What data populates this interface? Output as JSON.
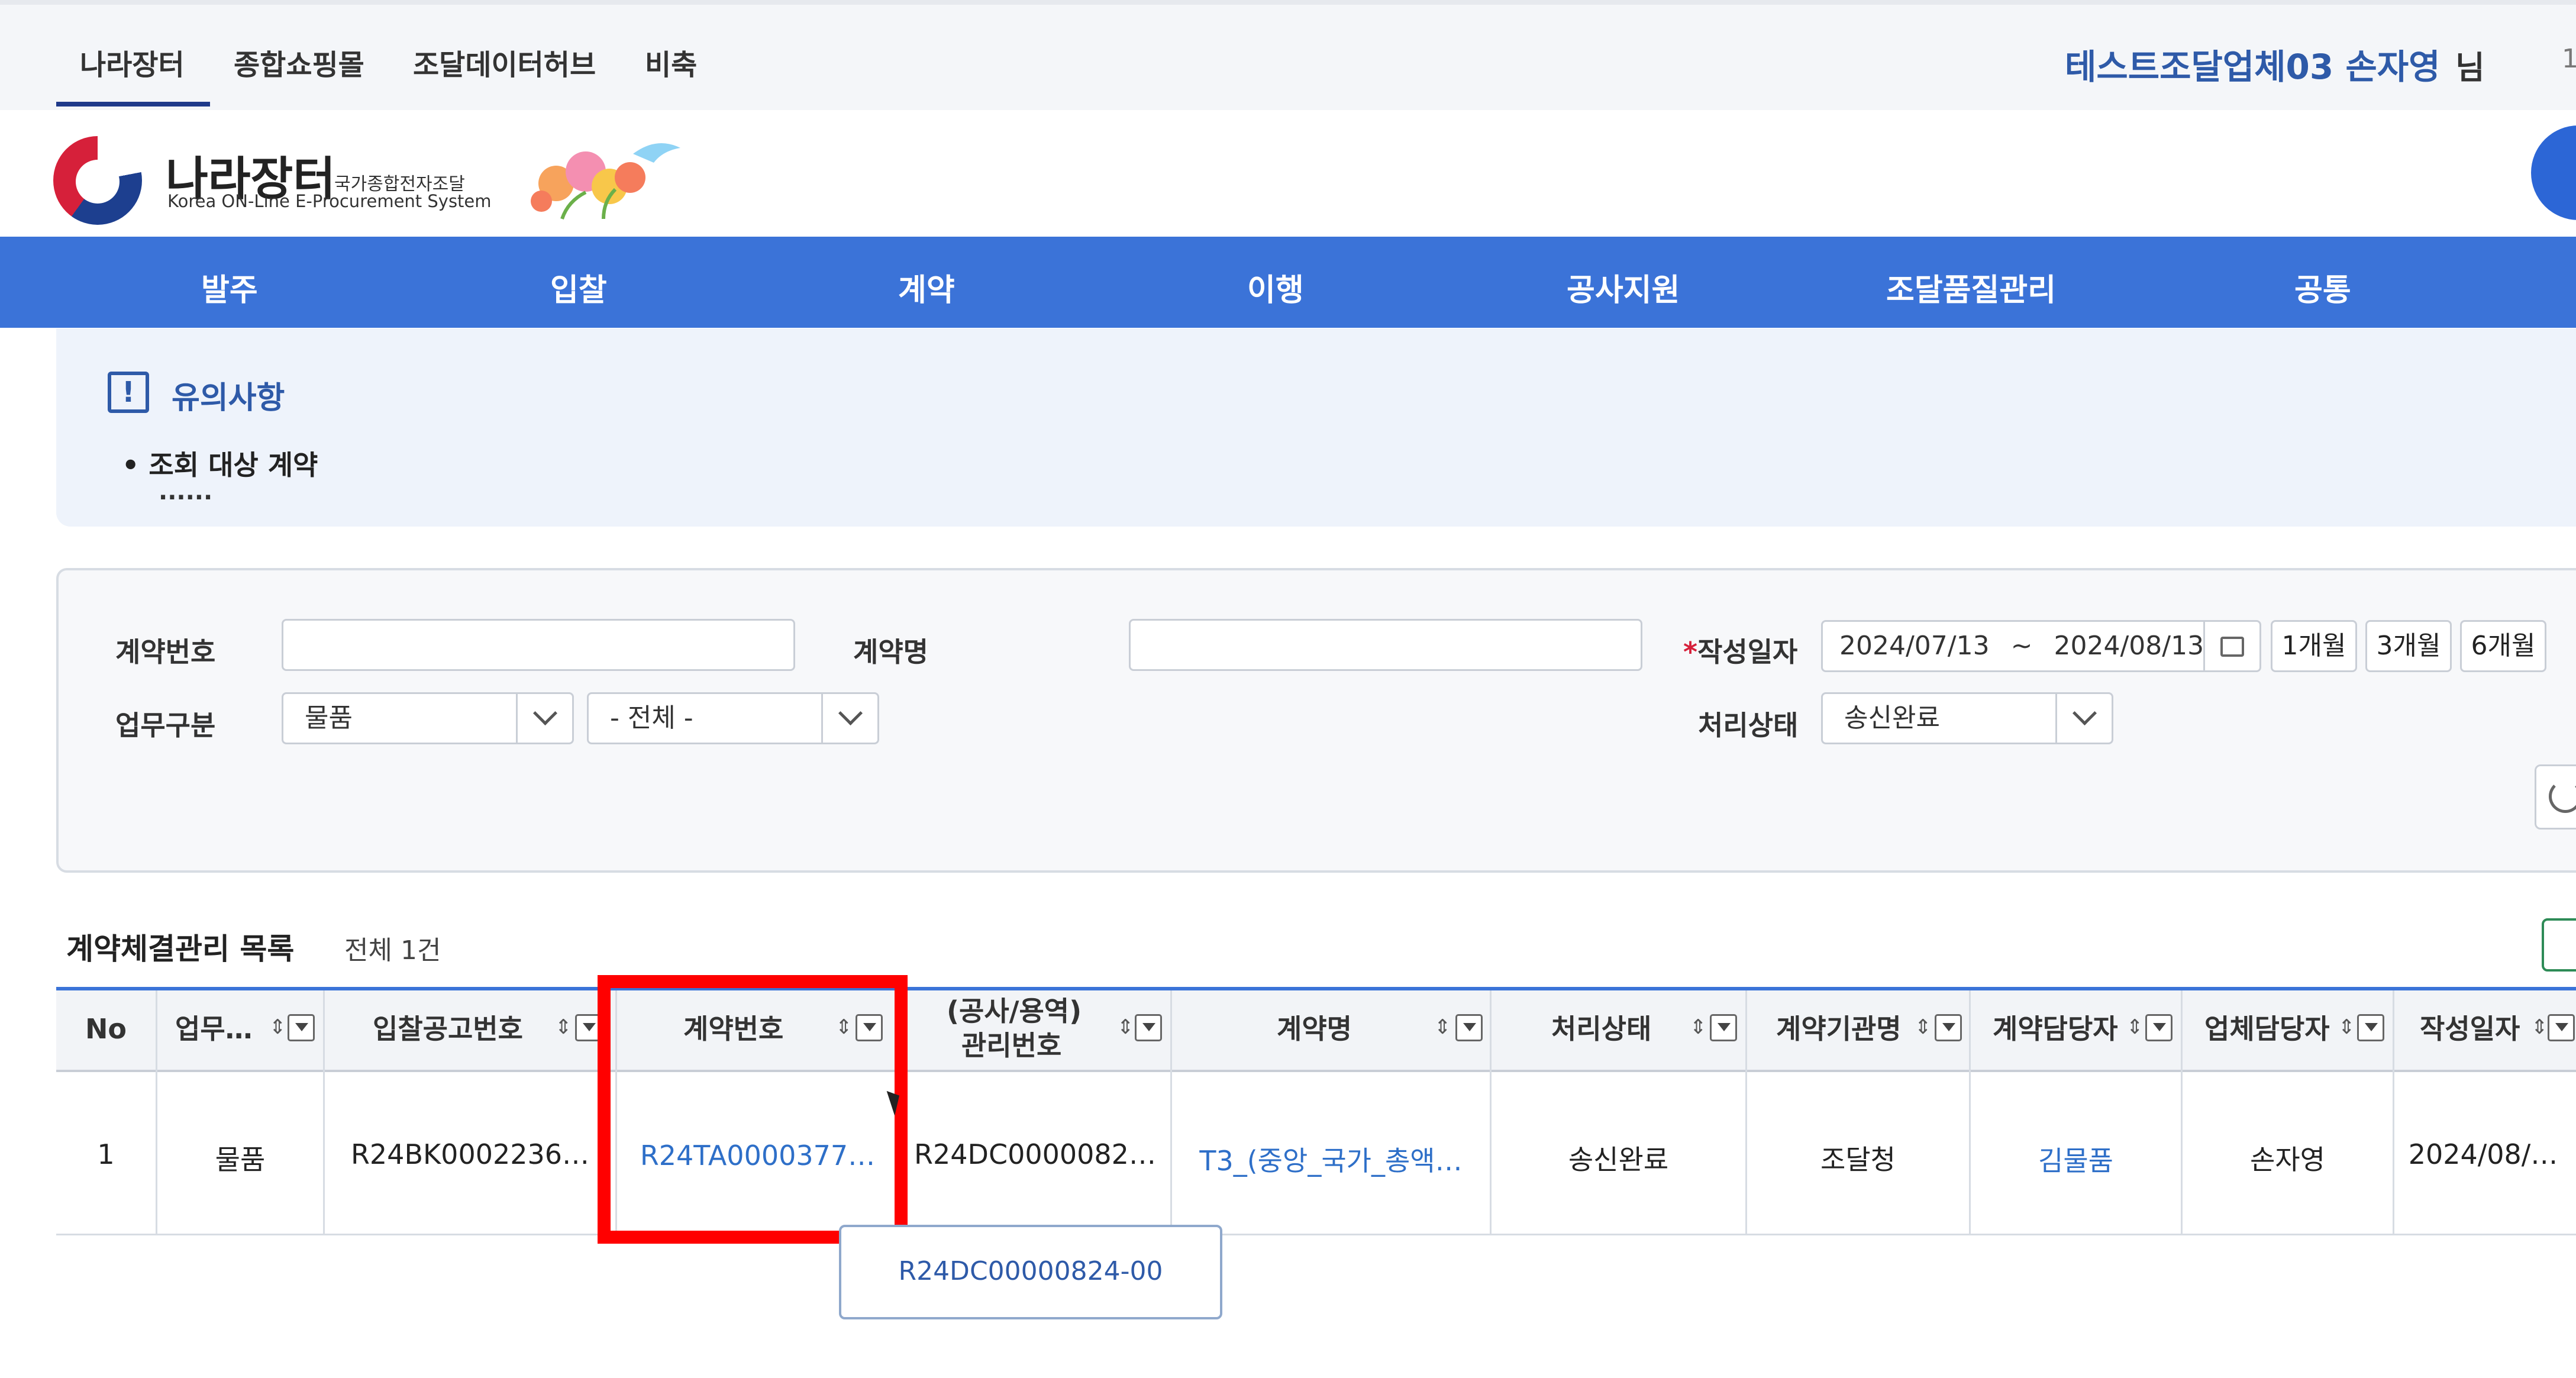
{
  "top_tabs": [
    "나라장터",
    "종합쇼핑몰",
    "조달데이터허브",
    "비축"
  ],
  "user": {
    "name": "테스트조달업체03 손자영",
    "suffix": "님",
    "extra": "1"
  },
  "logo": {
    "title": "나라장터",
    "subtitle_kr": "국가종합전자조달",
    "subtitle_en": "Korea ON-Line E-Procurement System"
  },
  "nav": [
    "발주",
    "입찰",
    "계약",
    "이행",
    "공사지원",
    "조달품질관리",
    "공통"
  ],
  "notice": {
    "icon": "!",
    "title": "유의사항",
    "bullet": "• 조회 대상 계약",
    "dots": "......"
  },
  "search": {
    "contract_no_label": "계약번호",
    "contract_name_label": "계약명",
    "date_label_req": "*",
    "date_label": "작성일자",
    "date_from": "2024/07/13",
    "date_sep": "~",
    "date_to": "2024/08/13",
    "quick": [
      "1개월",
      "3개월",
      "6개월"
    ],
    "biz_label": "업무구분",
    "biz_value": "물품",
    "biz_sub_value": "- 전체 -",
    "status_label": "처리상태",
    "status_value": "송신완료"
  },
  "list": {
    "title": "계약체결관리 목록",
    "count": "전체 1건",
    "headers": [
      "No",
      "업무…",
      "입찰공고번호",
      "계약번호",
      "(공사/용역)",
      "관리번호",
      "계약명",
      "처리상태",
      "계약기관명",
      "계약담당자",
      "업체담당자",
      "작성일자"
    ],
    "row": {
      "no": "1",
      "biz": "물품",
      "bid_no": "R24BK0002236…",
      "contract_no": "R24TA0000377…",
      "mgmt_no": "R24DC0000082…",
      "contract_name": "T3_(중앙_국가_총액…",
      "status": "송신완료",
      "agency": "조달청",
      "officer": "김물품",
      "company_person": "손자영",
      "date": "2024/08/…"
    },
    "sort_glyph": "⇕"
  },
  "tooltip": "R24DC00000824-00"
}
